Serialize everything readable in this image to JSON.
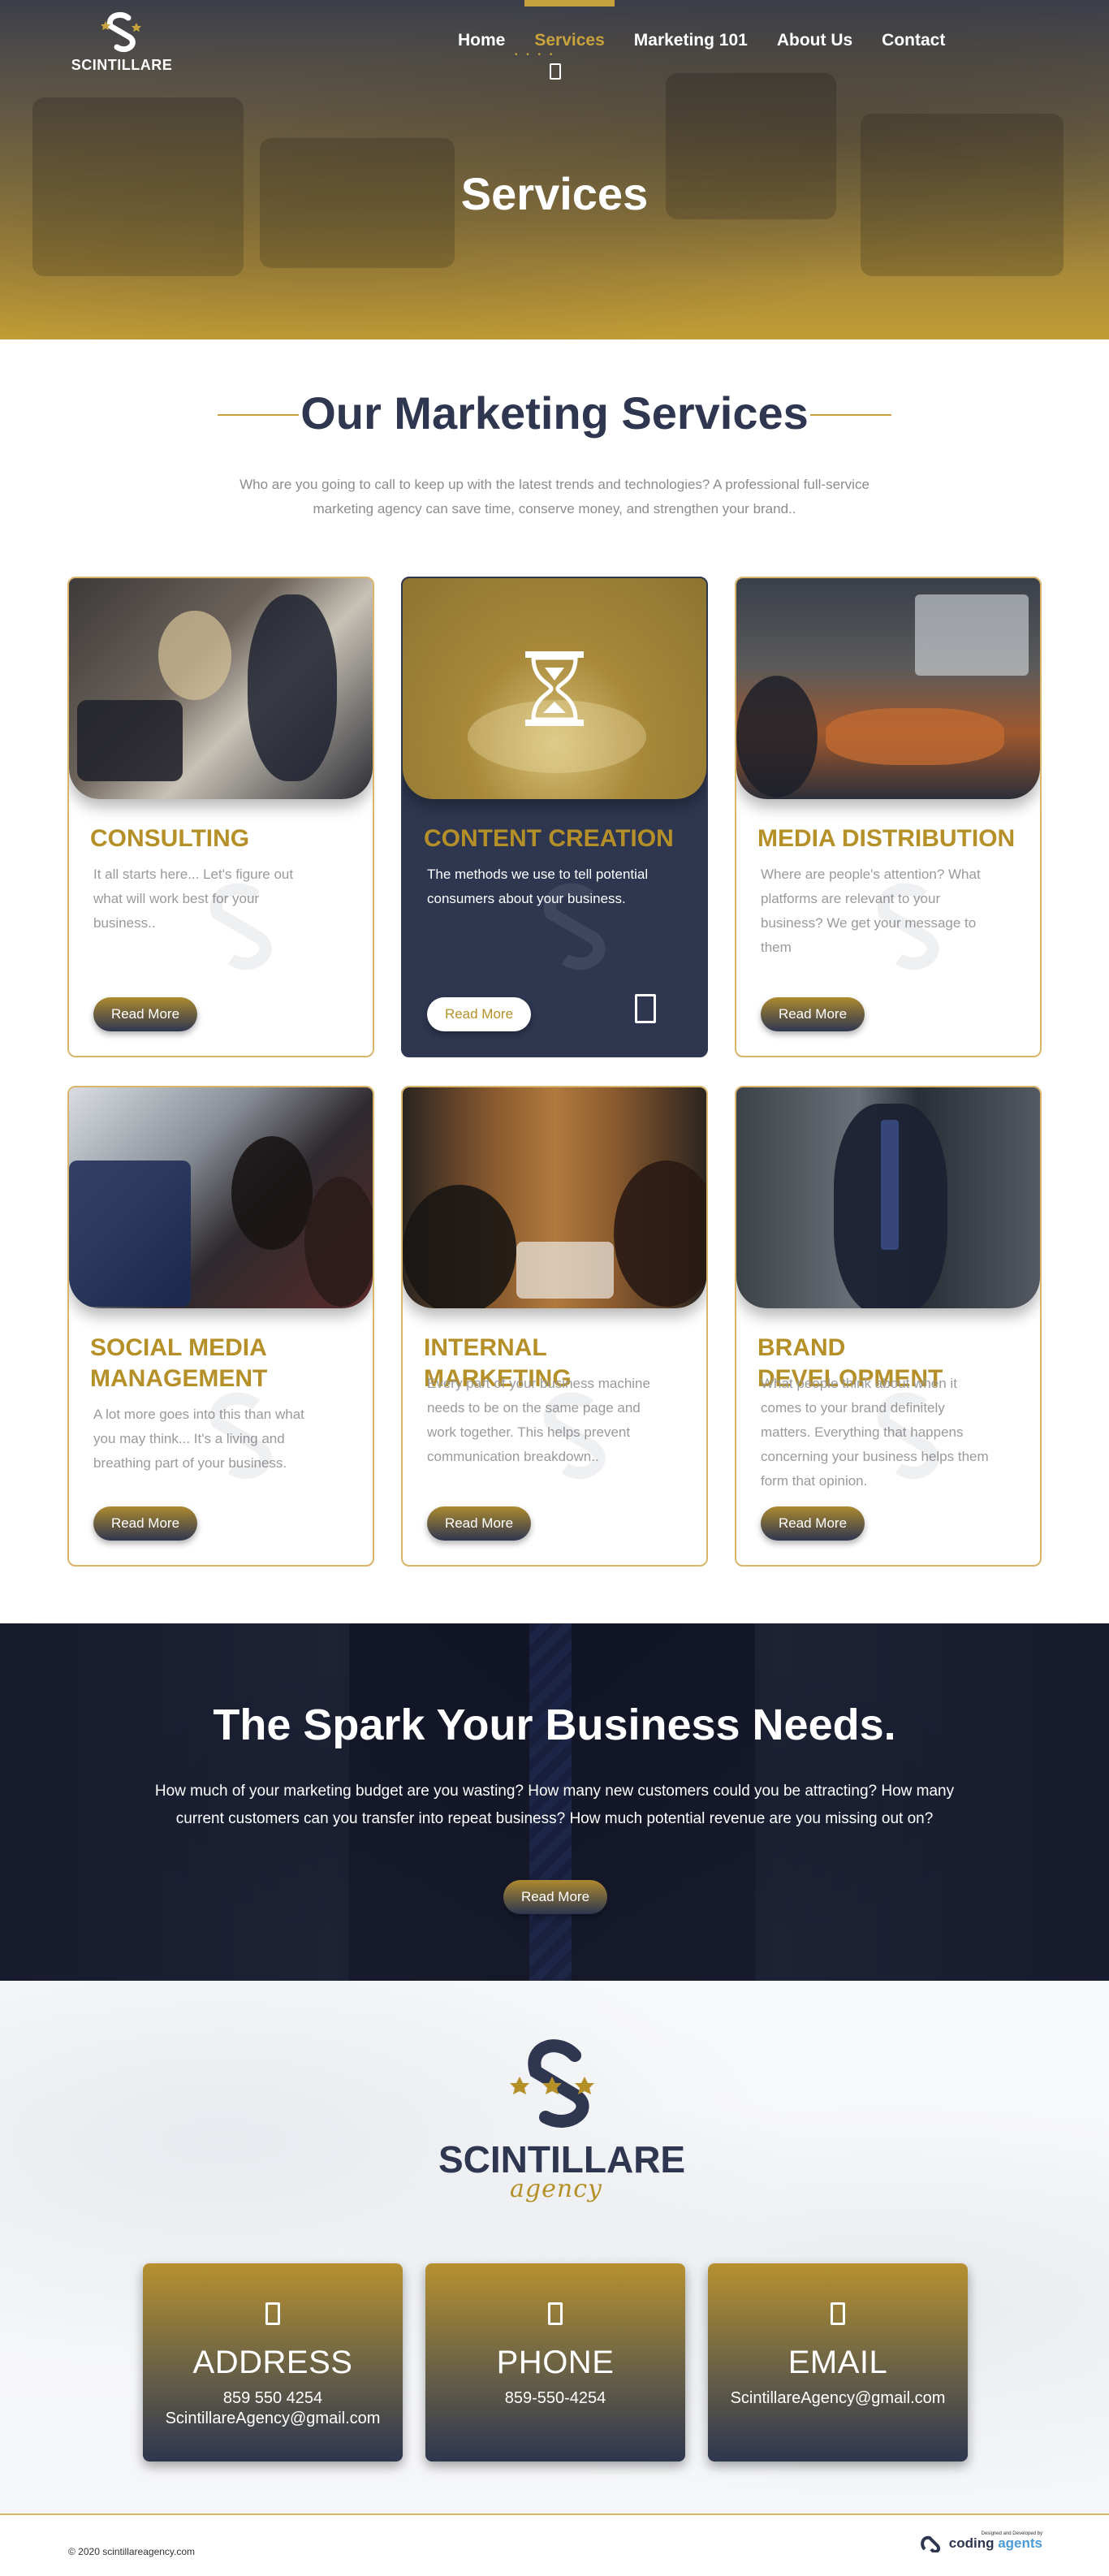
{
  "header": {
    "logo_text": "SCINTILLARE",
    "nav": [
      {
        "label": "Home",
        "active": false
      },
      {
        "label": "Services",
        "active": true
      },
      {
        "label": "Marketing 101",
        "active": false
      },
      {
        "label": "About Us",
        "active": false
      },
      {
        "label": "Contact",
        "active": false
      }
    ],
    "active_dots": "• • • •"
  },
  "hero": {
    "title": "Services"
  },
  "services": {
    "title": "Our Marketing Services",
    "subtitle": "Who are you going to call to keep up with the latest trends and technologies? A professional full-service marketing agency can save time, conserve money, and strengthen your brand..",
    "cards": [
      {
        "title": "CONSULTING",
        "text": "It all starts here... Let's figure out what will work best for your business..",
        "button": "Read More",
        "icon": "photo"
      },
      {
        "title": "CONTENT CREATION",
        "text": "The methods we use to tell potential consumers about your business.",
        "button": "Read More",
        "icon": "hourglass-icon"
      },
      {
        "title": "MEDIA DISTRIBUTION",
        "text": "Where are people's attention? What platforms are relevant to your business? We get your message to them",
        "button": "Read More",
        "icon": "photo"
      },
      {
        "title": "SOCIAL MEDIA MANAGEMENT",
        "text": "A lot more goes into this than what you may think... It's a living and breathing part of your business.",
        "button": "Read More",
        "icon": "photo"
      },
      {
        "title": "INTERNAL MARKETING",
        "text": "Every part of your business machine needs to be on the same page and work together. This helps prevent communication breakdown..",
        "button": "Read More",
        "icon": "photo"
      },
      {
        "title": "BRAND DEVELOPMENT",
        "text": "What people think about when it comes to your brand definitely matters. Everything that happens concerning your business helps them form that opinion.",
        "button": "Read More",
        "icon": "photo"
      }
    ]
  },
  "spark": {
    "title": "The Spark Your Business Needs.",
    "text": "How much of your marketing budget are you wasting? How many new customers could you be attracting? How many current customers can you transfer into repeat business? How much potential revenue are you missing out on?",
    "button": "Read More"
  },
  "footer": {
    "logo_name": "SCINTILLARE",
    "logo_script": "agency",
    "contacts": [
      {
        "heading": "ADDRESS",
        "line1": "859 550 4254",
        "line2": "ScintillareAgency@gmail.com"
      },
      {
        "heading": "PHONE",
        "line1": "859-550-4254",
        "line2": ""
      },
      {
        "heading": "EMAIL",
        "line1": "ScintillareAgency@gmail.com",
        "line2": ""
      }
    ],
    "copyright": "© 2020 scintillareagency.com",
    "credit_small": "Designed and Developed by",
    "credit_brand_a": "coding",
    "credit_brand_b": " agents"
  },
  "colors": {
    "navy": "#2e3650",
    "gold": "#b59028",
    "gold_light": "#c8a23d",
    "border": "#d8b56a"
  }
}
